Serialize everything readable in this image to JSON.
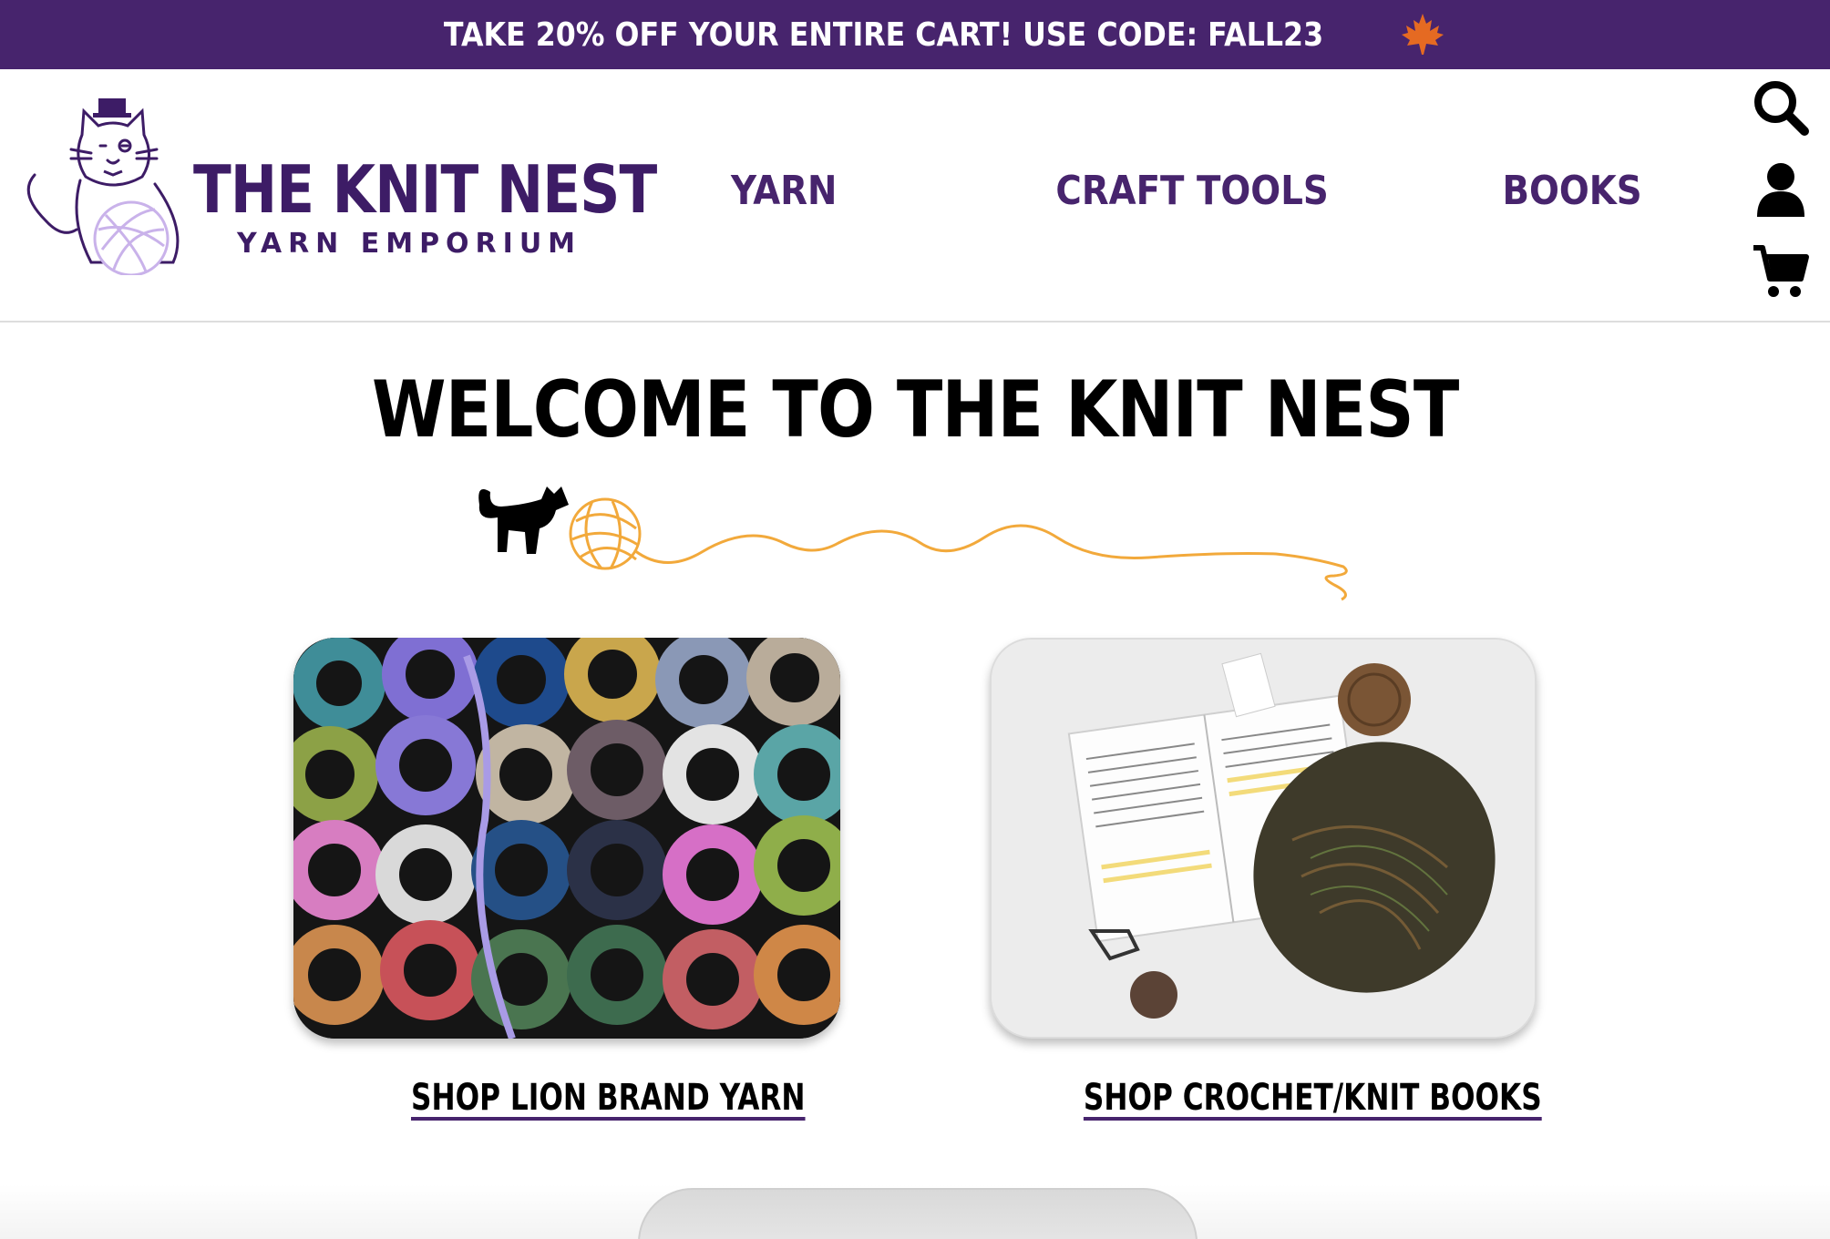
{
  "promo": {
    "text": "TAKE 20% OFF YOUR ENTIRE CART! USE CODE: FALL23",
    "icon": "maple-leaf-icon",
    "background": "#47246d"
  },
  "logo": {
    "title": "THE KNIT NEST",
    "subtitle": "YARN EMPORIUM"
  },
  "nav": {
    "yarn": "YARN",
    "craft_tools": "CRAFT TOOLS",
    "books": "BOOKS"
  },
  "header_icons": [
    "search-icon",
    "account-icon",
    "cart-icon"
  ],
  "main": {
    "heading": "WELCOME TO THE KNIT NEST",
    "cards": [
      {
        "link": "SHOP LION BRAND YARN",
        "image": "yarn-spools-photo"
      },
      {
        "link": "SHOP CROCHET/KNIT BOOKS",
        "image": "book-and-knitting-photo"
      }
    ]
  },
  "colors": {
    "brand_purple": "#47246d",
    "accent_orange": "#f2a93b",
    "lavender": "#d9c6f0"
  }
}
